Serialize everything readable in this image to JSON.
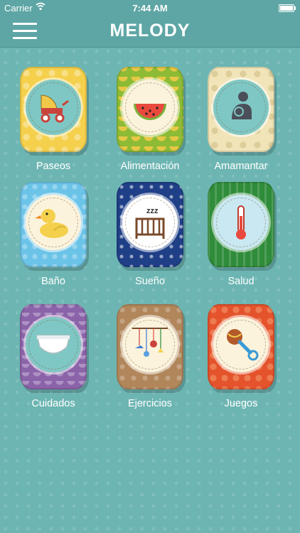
{
  "status": {
    "carrier": "Carrier",
    "time": "7:44 AM"
  },
  "header": {
    "logo": "MELODY"
  },
  "categories": [
    {
      "label": "Paseos",
      "icon": "stroller-icon"
    },
    {
      "label": "Alimentación",
      "icon": "watermelon-icon"
    },
    {
      "label": "Amamantar",
      "icon": "breastfeeding-icon"
    },
    {
      "label": "Baño",
      "icon": "rubber-duck-icon"
    },
    {
      "label": "Sueño",
      "icon": "crib-icon"
    },
    {
      "label": "Salud",
      "icon": "thermometer-icon"
    },
    {
      "label": "Cuidados",
      "icon": "diaper-icon"
    },
    {
      "label": "Ejercicios",
      "icon": "mobile-toy-icon"
    },
    {
      "label": "Juegos",
      "icon": "rattle-icon"
    }
  ],
  "colors": {
    "background": "#6cb5b2",
    "bar": "#5ea6a5",
    "paseos": "#f4d04c",
    "alimentacion": "#8dbb35",
    "amamantar": "#f1e4b8",
    "bano": "#6cc3e8",
    "sueno": "#1f3f87",
    "salud": "#2f8c3a",
    "cuidados": "#8a63a9",
    "ejercicios": "#b0865a",
    "juegos": "#e4532c"
  }
}
